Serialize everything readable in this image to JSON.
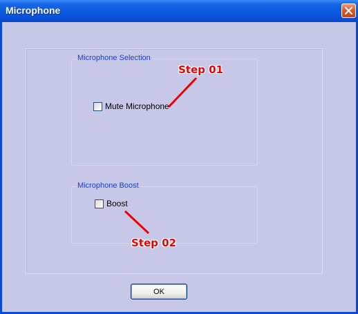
{
  "window": {
    "title": "Microphone",
    "close_icon": "close-x-icon"
  },
  "groups": {
    "selection": {
      "legend": "Microphone Selection",
      "checkbox_label": "Mute Microphone",
      "checked": false
    },
    "boost": {
      "legend": "Microphone Boost",
      "checkbox_label": "Boost",
      "checked": false
    }
  },
  "buttons": {
    "ok_label": "OK"
  },
  "annotations": {
    "step1": "Step 01",
    "step2": "Step 02",
    "color": "#ee0000"
  },
  "colors": {
    "titlebar": "#0a5ae0",
    "dialog_background": "#c7c8e8",
    "legend_text": "#1a40c8",
    "close_button": "#e2592c"
  }
}
